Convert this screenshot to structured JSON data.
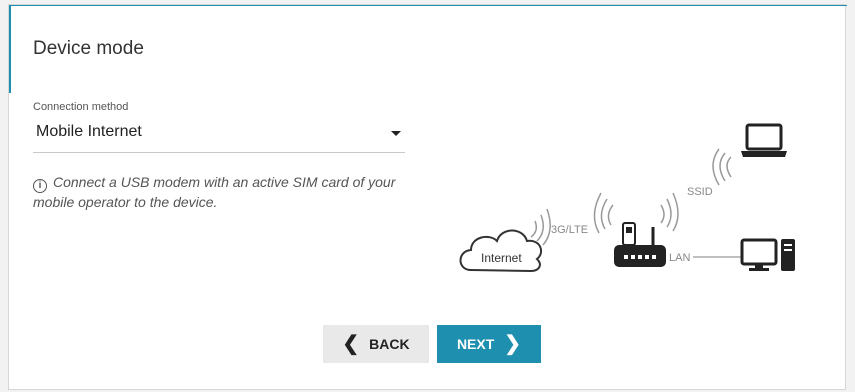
{
  "page": {
    "title": "Device mode"
  },
  "connection": {
    "label": "Connection method",
    "selected": "Mobile Internet",
    "hint": "Connect a USB modem with an active SIM card of your mobile operator to the device."
  },
  "diagram": {
    "internet_label": "Internet",
    "link_label": "3G/LTE",
    "ssid_label": "SSID",
    "lan_label": "LAN"
  },
  "buttons": {
    "back_label": "BACK",
    "next_label": "NEXT"
  },
  "colors": {
    "accent": "#1f8fb0",
    "background": "#f2f2f2",
    "back_button": "#e9e9e9"
  },
  "icons": [
    "info-icon",
    "cloud-icon",
    "wifi-signal-icon",
    "router-icon",
    "usb-modem-icon",
    "laptop-icon",
    "desktop-computer-icon",
    "chevron-left-icon",
    "chevron-right-icon",
    "caret-down-icon"
  ]
}
